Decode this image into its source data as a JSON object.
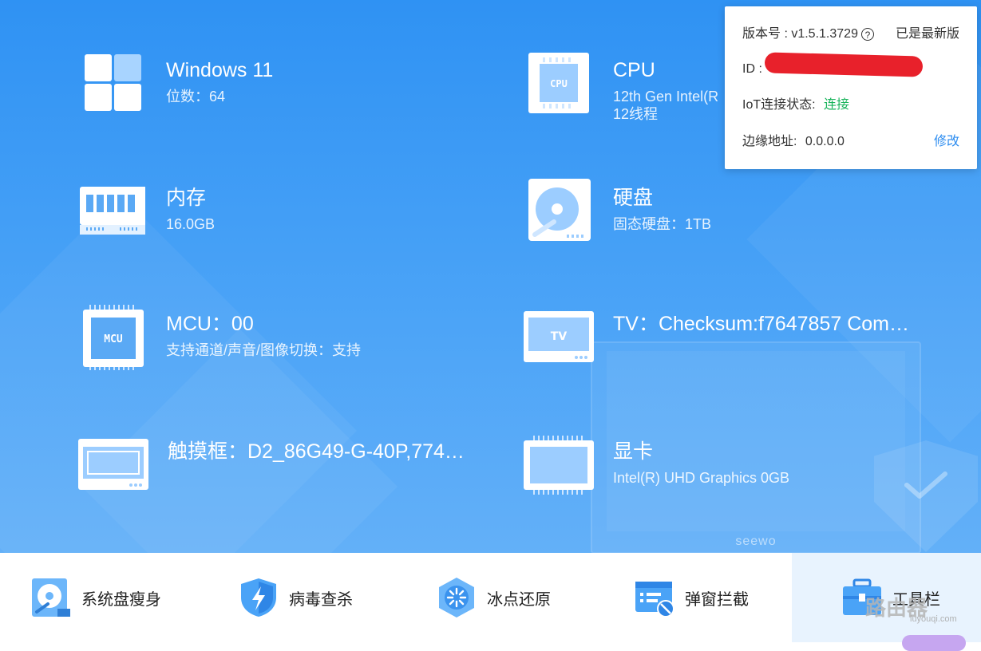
{
  "system_info": {
    "os": {
      "title": "Windows 11",
      "sub": "位数：64"
    },
    "cpu": {
      "title": "CPU",
      "sub": "12th Gen Intel(R",
      "sub2": "12线程",
      "chip_label": "CPU"
    },
    "memory": {
      "title": "内存",
      "sub": "16.0GB"
    },
    "disk": {
      "title": "硬盘",
      "sub": "固态硬盘：1TB"
    },
    "mcu": {
      "title": "MCU：00",
      "sub": "支持通道/声音/图像切换：支持",
      "chip_label": "MCU"
    },
    "tv": {
      "title": "TV：Checksum:f7647857 Com…",
      "screen_label": "TV"
    },
    "touch": {
      "title": "触摸框：D2_86G49-G-40P,774…"
    },
    "gpu": {
      "title": "显卡",
      "sub": "Intel(R) UHD Graphics 0GB"
    }
  },
  "background": {
    "brand": "seewo"
  },
  "popup": {
    "version_label": "版本号 : v1.5.1.3729",
    "help_glyph": "?",
    "latest_status": "已是最新版",
    "id_label": "ID :",
    "iot_label": "IoT连接状态:",
    "iot_status": "连接",
    "edge_label": "边缘地址:",
    "edge_value": "0.0.0.0",
    "edit_link": "修改"
  },
  "bottom_tools": [
    {
      "label": "系统盘瘦身",
      "icon": "disk-clean-icon"
    },
    {
      "label": "病毒查杀",
      "icon": "shield-lightning-icon"
    },
    {
      "label": "冰点还原",
      "icon": "snowflake-restore-icon"
    },
    {
      "label": "弹窗拦截",
      "icon": "popup-block-icon"
    },
    {
      "label": "工具栏",
      "icon": "toolbox-icon"
    }
  ],
  "watermark": {
    "main": "路由器",
    "sub": "luyouqi.com"
  },
  "colors": {
    "primary_bg": "#2f92f3",
    "link": "#2c8cf0",
    "connected": "#17b35a",
    "redaction": "#e8212b",
    "active_tab_bg": "#e8f3fe"
  }
}
